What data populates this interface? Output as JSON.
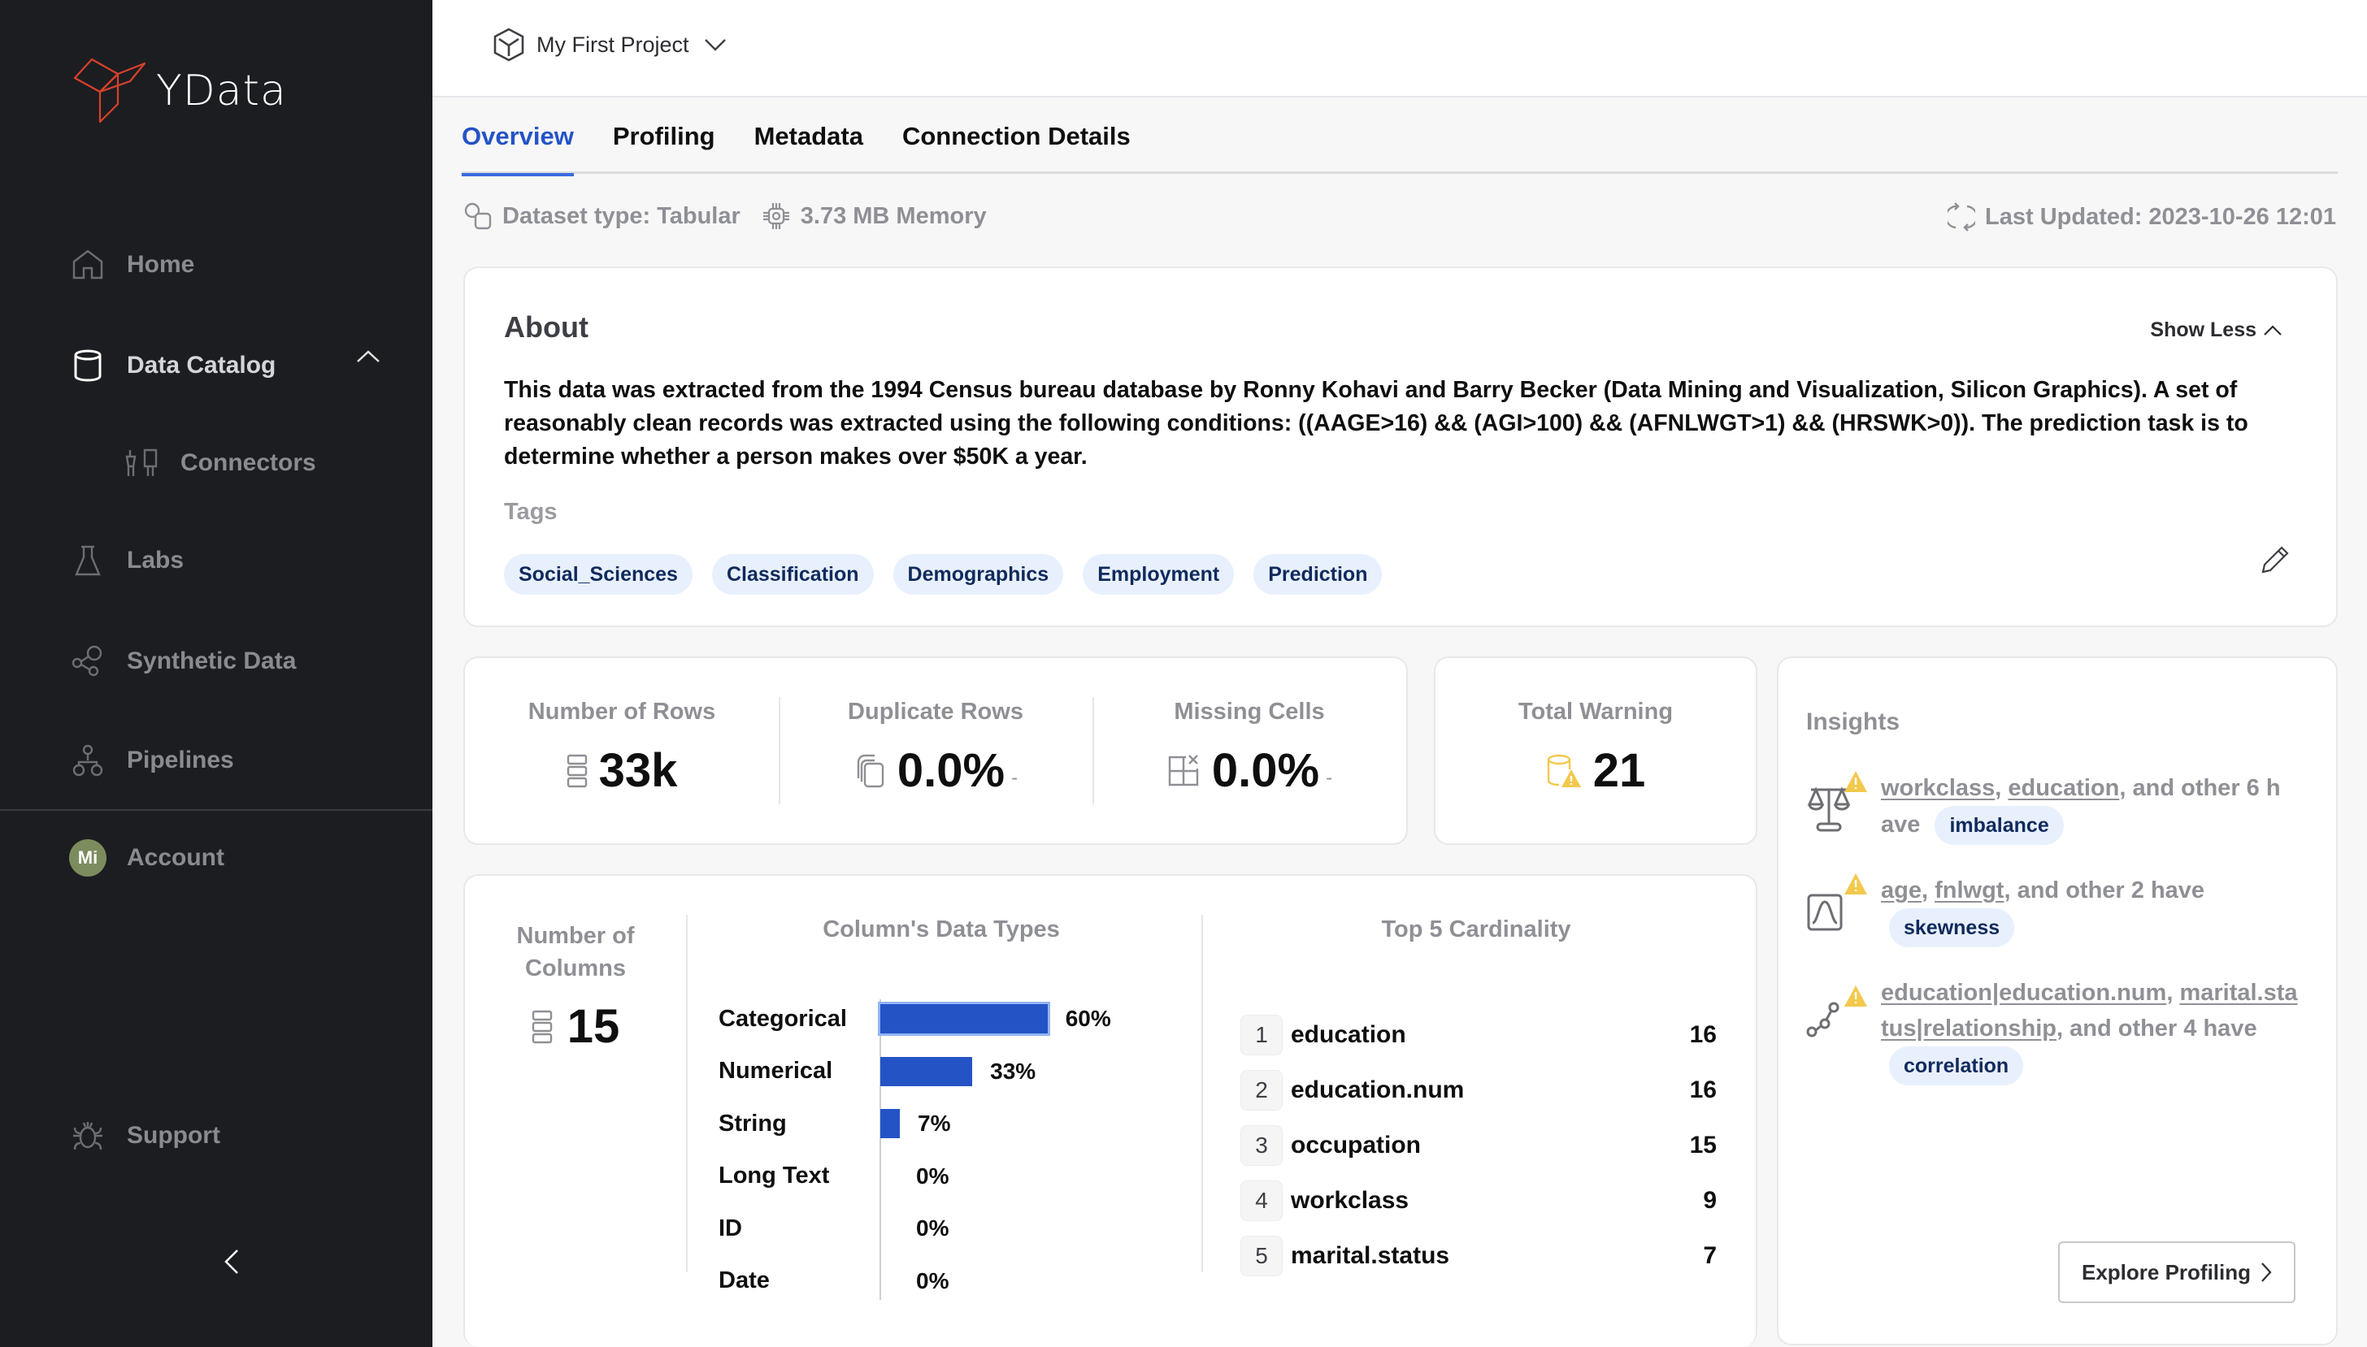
{
  "app": {
    "brand": "YData"
  },
  "sidebar": {
    "items": [
      {
        "label": "Home",
        "icon": "home-icon"
      },
      {
        "label": "Data Catalog",
        "icon": "database-icon",
        "expanded": true
      },
      {
        "label": "Connectors",
        "icon": "plug-icon"
      },
      {
        "label": "Labs",
        "icon": "flask-icon"
      },
      {
        "label": "Synthetic Data",
        "icon": "share-nodes-icon"
      },
      {
        "label": "Pipelines",
        "icon": "pipeline-icon"
      }
    ],
    "account": {
      "label": "Account",
      "initials": "Mi"
    },
    "support": {
      "label": "Support"
    }
  },
  "topbar": {
    "project": "My First Project"
  },
  "tabs": [
    {
      "label": "Overview",
      "active": true
    },
    {
      "label": "Profiling"
    },
    {
      "label": "Metadata"
    },
    {
      "label": "Connection Details"
    }
  ],
  "meta": {
    "dataset_type": "Dataset type: Tabular",
    "memory": "3.73 MB Memory",
    "last_updated": "Last Updated: 2023-10-26 12:01"
  },
  "about": {
    "title": "About",
    "toggle": "Show Less",
    "description": "This data was extracted from the 1994 Census bureau database by Ronny Kohavi and Barry Becker (Data Mining and Visualization, Silicon Graphics). A set of reasonably clean records was extracted using the following conditions: ((AAGE>16) && (AGI>100) && (AFNLWGT>1) && (HRSWK>0)). The prediction task is to determine whether a person makes over $50K a year.",
    "tags_label": "Tags",
    "tags": [
      "Social_Sciences",
      "Classification",
      "Demographics",
      "Employment",
      "Prediction"
    ]
  },
  "stats": {
    "rows": {
      "label": "Number of Rows",
      "value": "33k"
    },
    "duplicates": {
      "label": "Duplicate Rows",
      "value": "0.0%",
      "suffix": "-"
    },
    "missing": {
      "label": "Missing Cells",
      "value": "0.0%",
      "suffix": "-"
    },
    "warnings": {
      "label": "Total Warning",
      "value": "21"
    }
  },
  "columns": {
    "count_label": "Number of Columns",
    "count": "15",
    "types_title": "Column's Data Types",
    "cardinality_title": "Top 5 Cardinality",
    "cardinality": [
      {
        "rank": "1",
        "name": "education",
        "value": "16"
      },
      {
        "rank": "2",
        "name": "education.num",
        "value": "16"
      },
      {
        "rank": "3",
        "name": "occupation",
        "value": "15"
      },
      {
        "rank": "4",
        "name": "workclass",
        "value": "9"
      },
      {
        "rank": "5",
        "name": "marital.status",
        "value": "7"
      }
    ]
  },
  "chart_data": {
    "type": "bar",
    "orientation": "horizontal",
    "title": "Column's Data Types",
    "categories": [
      "Categorical",
      "Numerical",
      "String",
      "Long Text",
      "ID",
      "Date"
    ],
    "values": [
      60,
      33,
      7,
      0,
      0,
      0
    ],
    "value_labels": [
      "60%",
      "33%",
      "7%",
      "0%",
      "0%",
      "0%"
    ],
    "xlim": [
      0,
      100
    ],
    "unit": "%",
    "color": "#2453c6"
  },
  "insights": {
    "title": "Insights",
    "items": [
      {
        "icon": "scale-icon",
        "links": [
          "workclass",
          "education"
        ],
        "rest": "and other 6 h ave",
        "badge": "imbalance"
      },
      {
        "icon": "distribution-icon",
        "links": [
          "age",
          "fnlwgt"
        ],
        "rest": "and other 2 have",
        "badge": "skewness"
      },
      {
        "icon": "correlation-icon",
        "links": [
          "education|education.num",
          "marital.status|relationship"
        ],
        "rest": "and other 4 have",
        "badge": "correlation"
      }
    ],
    "explore_button": "Explore Profiling"
  },
  "colors": {
    "accent": "#2453c6",
    "warning": "#f2c94c",
    "sidebar_bg": "#1c1d21",
    "logo": "#d8412b"
  }
}
